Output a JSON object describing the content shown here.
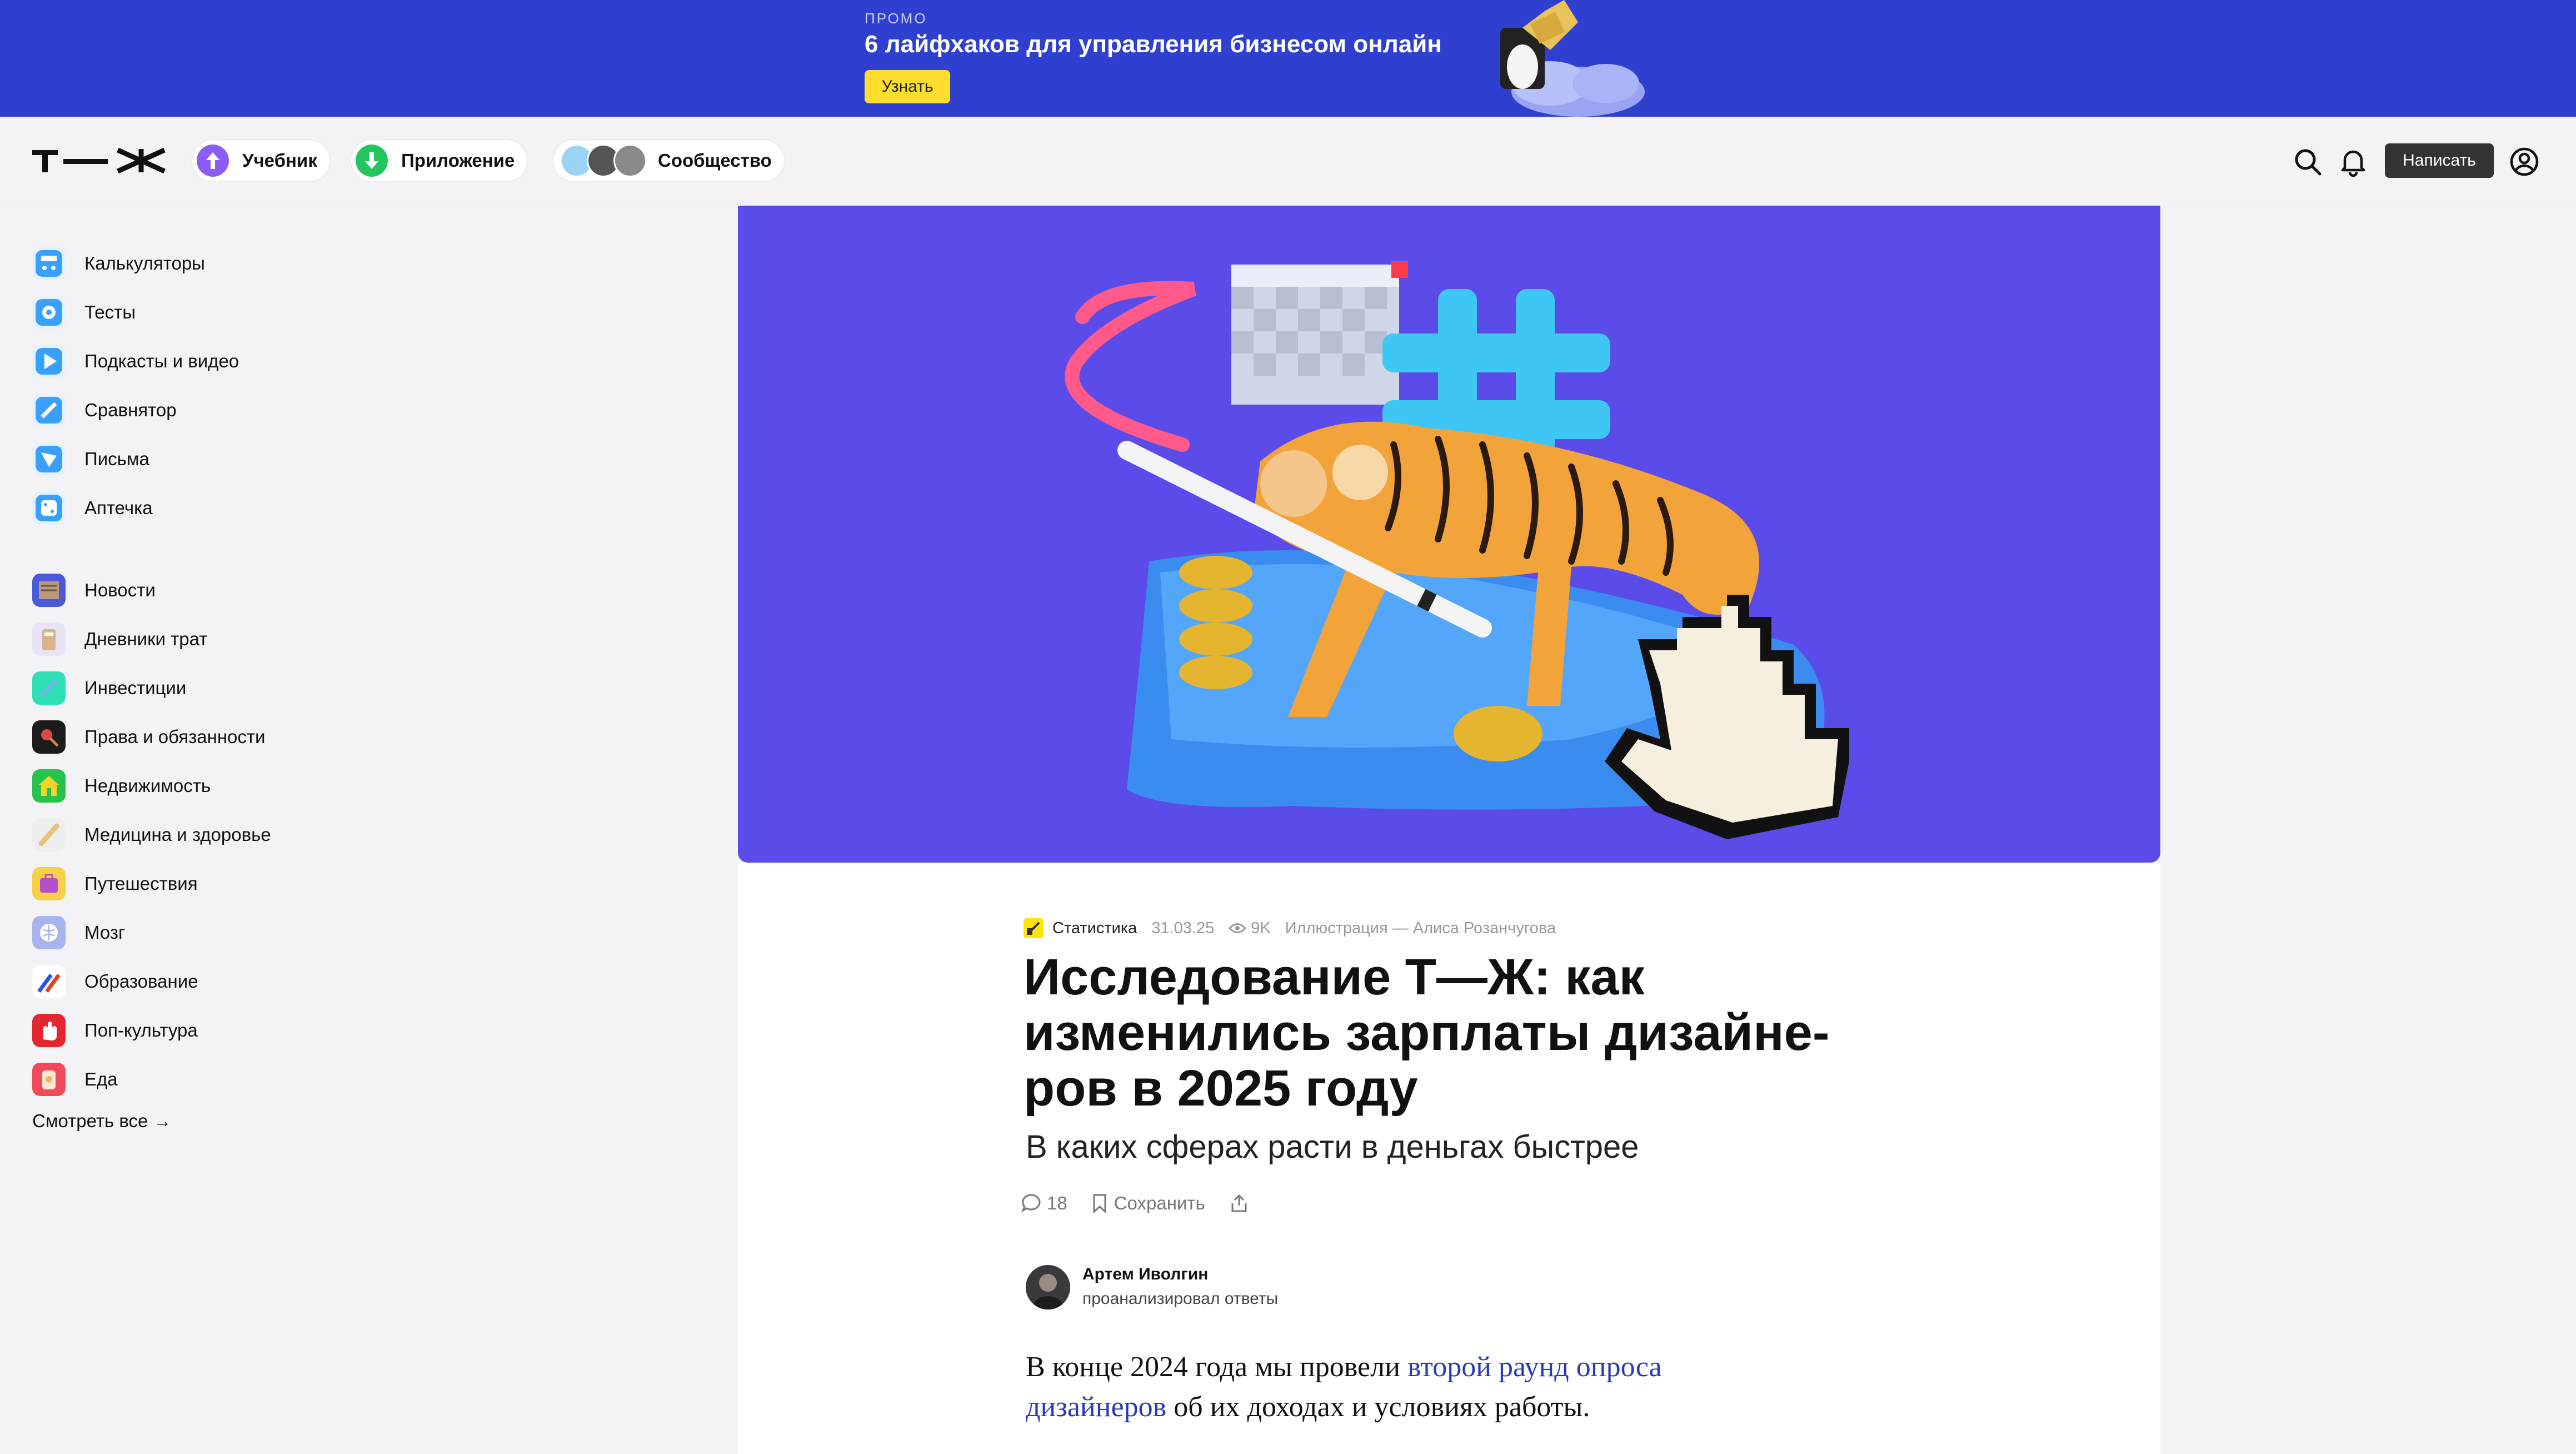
{
  "promo": {
    "eyebrow": "ПРОМО",
    "title": "6 лайфхаков для управления бизнесом онлайн",
    "button": "Узнать"
  },
  "header": {
    "logo": "Т—Ж",
    "pills": [
      {
        "label": "Учебник",
        "icon": "arrow-up-icon",
        "color": "#8b5cf6"
      },
      {
        "label": "Приложение",
        "icon": "arrow-down-icon",
        "color": "#22c55e"
      },
      {
        "label": "Сообщество",
        "icon": "community-avatars"
      }
    ],
    "write_button": "Написать",
    "icons": [
      "search-icon",
      "bell-icon",
      "profile-icon"
    ]
  },
  "sidebar": {
    "group1": [
      {
        "label": "Калькуляторы",
        "icon": "calculator-icon",
        "color": "#3aa0ff"
      },
      {
        "label": "Тесты",
        "icon": "tests-icon",
        "color": "#3aa0ff"
      },
      {
        "label": "Подкасты и видео",
        "icon": "podcast-icon",
        "color": "#3aa0ff"
      },
      {
        "label": "Сравнятор",
        "icon": "compare-icon",
        "color": "#3aa0ff"
      },
      {
        "label": "Письма",
        "icon": "letters-icon",
        "color": "#3aa0ff"
      },
      {
        "label": "Аптечка",
        "icon": "first-aid-icon",
        "color": "#3aa0ff"
      }
    ],
    "group2": [
      {
        "label": "Новости",
        "icon": "news-icon",
        "color": "#4a59d8"
      },
      {
        "label": "Дневники трат",
        "icon": "diaries-icon",
        "color": "#cfc8e8"
      },
      {
        "label": "Инвестиции",
        "icon": "investments-icon",
        "color": "#2de0b5"
      },
      {
        "label": "Права и обязанности",
        "icon": "rights-icon",
        "color": "#1b1b1b"
      },
      {
        "label": "Недвижимость",
        "icon": "real-estate-icon",
        "color": "#27c24c"
      },
      {
        "label": "Медицина и здоровье",
        "icon": "medicine-icon",
        "color": "#eeeeee"
      },
      {
        "label": "Путешествия",
        "icon": "travel-icon",
        "color": "#f7d04a"
      },
      {
        "label": "Мозг",
        "icon": "brain-icon",
        "color": "#a8b3f0"
      },
      {
        "label": "Образование",
        "icon": "education-icon",
        "color": "#ffffff"
      },
      {
        "label": "Поп-культура",
        "icon": "pop-culture-icon",
        "color": "#e3262f"
      },
      {
        "label": "Еда",
        "icon": "food-icon",
        "color": "#f04a5a"
      }
    ],
    "see_all": "Смотреть все →"
  },
  "article": {
    "category": "Статистика",
    "date": "31.03.25",
    "views": "9K",
    "illustration_credit": "Иллюстрация — Алиса Розанчугова",
    "title": "Исследование Т—Ж: как изменились зарплаты дизайне­ров в 2025 году",
    "subtitle": "В каких сферах расти в деньгах быстрее",
    "comments_count": "18",
    "save_label": "Сохранить",
    "author": {
      "name": "Артем Иволгин",
      "role": "проанализировал ответы"
    },
    "lead": {
      "before": "В конце 2024 года мы провели ",
      "link": "второй раунд опроса дизайнеров",
      "after": " об их доходах и условиях работы."
    }
  },
  "colors": {
    "promo_bg": "#2f40d0",
    "promo_button": "#ffdd2d",
    "hero_bg": "#5b4ce9",
    "link": "#2b3ab3",
    "write_button_bg": "#333333"
  }
}
